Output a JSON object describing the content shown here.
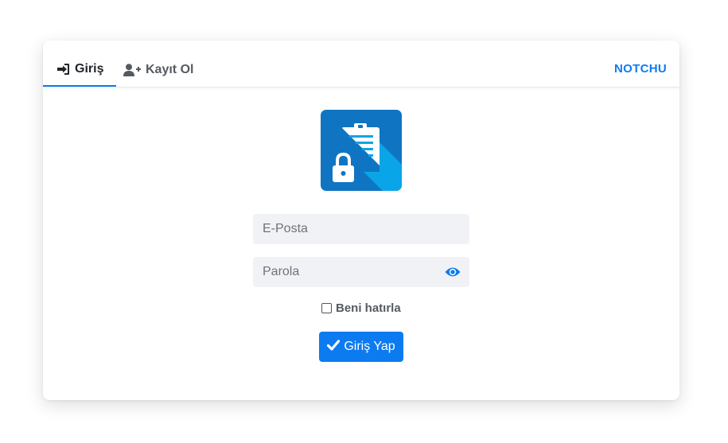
{
  "tabs": {
    "login_label": "Giriş",
    "signup_label": "Kayıt Ol",
    "active": "login",
    "login_icon": "sign-in-icon",
    "signup_icon": "user-plus-icon"
  },
  "brand": {
    "label": "NOTCHU"
  },
  "logo": {
    "icon": "clipboard-lock-icon"
  },
  "form": {
    "email_placeholder": "E-Posta",
    "email_value": "",
    "password_placeholder": "Parola",
    "password_value": "",
    "show_password_icon": "eye-icon",
    "remember_label": "Beni hatırla",
    "remember_checked": false,
    "submit_label": "Giriş Yap",
    "submit_icon": "check-icon"
  },
  "colors": {
    "accent": "#0d7bf0",
    "logo_bg": "#0f75c3",
    "logo_fold": "#0aa5e8",
    "field_bg": "#f1f2f5"
  }
}
